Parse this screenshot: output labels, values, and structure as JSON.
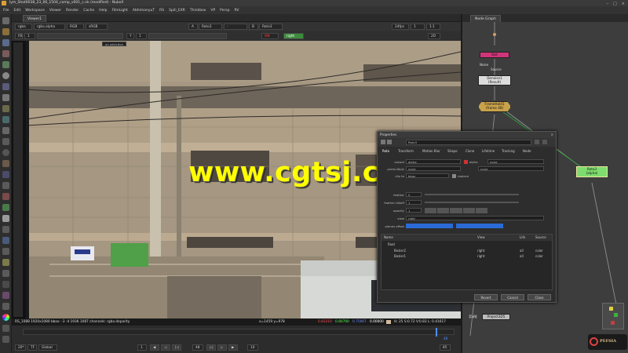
{
  "window": {
    "title": "lym_Shot0038_23_06_1504_comp_v001_c.nk (modified) - NukeX",
    "controls": [
      "–",
      "□",
      "×"
    ]
  },
  "menu": [
    "File",
    "Edit",
    "Workspace",
    "Viewer",
    "Render",
    "Cache",
    "Help",
    "FilmLight",
    "AbhimanyuT",
    "RS",
    "Spili_EXR",
    "Thinkbox",
    "VP",
    "Persp",
    "RV"
  ],
  "viewer": {
    "tab_label": "Viewer1",
    "channels": "rgba",
    "layer": "rgba.alpha",
    "display": "RGB",
    "colorspace": "sRGB",
    "input_a": "A",
    "input_a_node": "Roto3",
    "input_dash": "-",
    "input_b": "B",
    "input_b_node": "Roto3",
    "fps": "24fps",
    "frame": "1",
    "zoom": "1:1",
    "mode_2d": "2D",
    "gain_label": "f/8",
    "gain_value": "1",
    "gamma_label": "Y",
    "gamma_value": "1",
    "red_toggle": "ON",
    "right_toggle": "right",
    "selection_mode": "on selection"
  },
  "status": {
    "format_info": "RS_1088 1920x1080 bbox: -3 -4 1936 1087 channels: rgba.deparity",
    "coords": "x=1459 y=978",
    "red": "0.83210",
    "green": "0.80790",
    "blue": "0.75667",
    "alpha": "0.00000",
    "hsvl": "H: 25 S:0.72 V:0.83 L: 0.41617"
  },
  "timeline": {
    "range": "20*",
    "mode": "TF",
    "scope": "Global",
    "frame_fields": [
      "1",
      "48"
    ],
    "frame_current": "48",
    "end_frame": "85",
    "step": "10"
  },
  "nodegraph": {
    "tab_label": "Node Graph",
    "nodes": {
      "pink_node": "Dot",
      "noise_label": "Noise",
      "source_label": "Source",
      "denoise_title": "Denoise1",
      "denoise_sub": "(Result)",
      "framehold_title": "FrameHold1",
      "framehold_sub": "(frame 48)",
      "roto_title": "Roto3",
      "roto_sub": "(alpha)",
      "project_title": "Project3D5",
      "cam_label": "Cam"
    },
    "logo_text": "PEFSIA"
  },
  "properties": {
    "panel_title": "Properties",
    "node_name": "Roto3",
    "tabs": [
      "Roto",
      "Transform",
      "Motion Blur",
      "Shape",
      "Clone",
      "Lifetime",
      "Tracking",
      "Node"
    ],
    "output_label": "output",
    "output_value": "alpha",
    "output_alpha": "alpha",
    "output_none": "none",
    "premultiply_label": "premultiply",
    "premultiply_value": "none",
    "premultiply_none": "none",
    "clip_label": "clip to",
    "clip_value": "bbox",
    "replace_label": "replace",
    "feather_label": "feather",
    "feather_value": "0",
    "feather_falloff_label": "feather falloff",
    "feather_falloff_value": "1",
    "opacity_label": "opacity",
    "opacity_value": "1",
    "view_label": "view",
    "view_value": "right",
    "stereo_label": "planes offset",
    "tree_headers": [
      "Name",
      "View",
      "Life",
      "Source"
    ],
    "tree_rows": [
      {
        "name": "Root",
        "view": "",
        "life": "",
        "source": ""
      },
      {
        "name": "Bezier2",
        "view": "right",
        "life": "all",
        "source": "color"
      },
      {
        "name": "Bezier1",
        "view": "right",
        "life": "all",
        "source": "color"
      }
    ],
    "buttons": {
      "revert": "Revert",
      "cancel": "Cancel",
      "close": "Close"
    }
  },
  "watermark": "www.cgtsj.com"
}
